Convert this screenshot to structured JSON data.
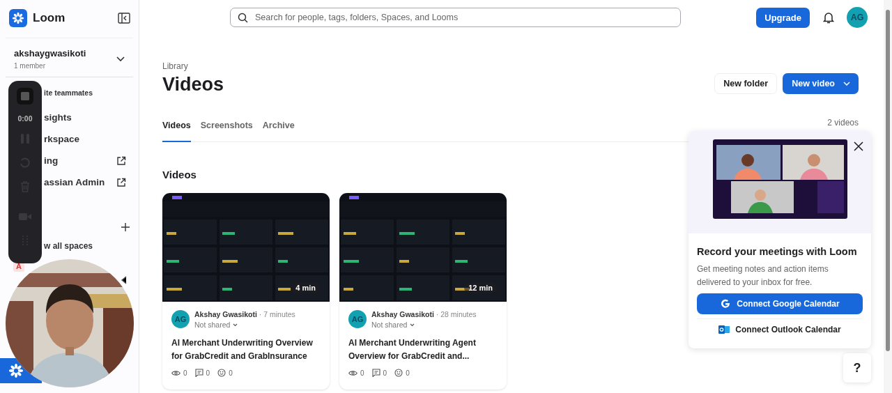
{
  "sidebar": {
    "brand": "Loom",
    "workspace": {
      "name": "akshaygwasikoti",
      "members": "1 member"
    },
    "items": [
      {
        "label": "ite teammates",
        "kind": "small"
      },
      {
        "label": "sights",
        "kind": "plain"
      },
      {
        "label": "rkspace",
        "kind": "plain"
      },
      {
        "label": "ing",
        "kind": "external"
      },
      {
        "label": "assian Admin",
        "kind": "external"
      }
    ],
    "spaces_link": "w all spaces",
    "space_badge": "A"
  },
  "recorder": {
    "time": "0:00"
  },
  "topbar": {
    "search": {
      "placeholder": "Search for people, tags, folders, Spaces, and Looms"
    },
    "upgrade": "Upgrade",
    "avatar": "AG"
  },
  "header": {
    "breadcrumb": "Library",
    "title": "Videos",
    "new_folder": "New folder",
    "new_video": "New video"
  },
  "tabs": [
    {
      "label": "Videos",
      "selected": true
    },
    {
      "label": "Screenshots",
      "selected": false
    },
    {
      "label": "Archive",
      "selected": false
    }
  ],
  "count": "2 videos",
  "section": "Videos",
  "videos": [
    {
      "duration": "4 min",
      "avatar": "AG",
      "author": "Akshay Gwasikoti",
      "separator": "·",
      "age": "7 minutes",
      "sharing": "Not shared",
      "title": "AI Merchant Underwriting Overview for GrabCredit and GrabInsurance",
      "views": "0",
      "comments": "0",
      "reactions": "0"
    },
    {
      "duration": "12 min",
      "avatar": "AG",
      "author": "Akshay Gwasikoti",
      "separator": "·",
      "age": "28 minutes",
      "sharing": "Not shared",
      "title": "AI Merchant Underwriting Agent Overview for GrabCredit and...",
      "views": "0",
      "comments": "0",
      "reactions": "0"
    }
  ],
  "promo": {
    "title": "Record your meetings with Loom",
    "text": "Get meeting notes and action items delivered to your inbox for free.",
    "buttons": [
      {
        "label": "Connect Google Calendar",
        "kind": "google"
      },
      {
        "label": "Connect Outlook Calendar",
        "kind": "outlook"
      }
    ]
  },
  "help": "?"
}
